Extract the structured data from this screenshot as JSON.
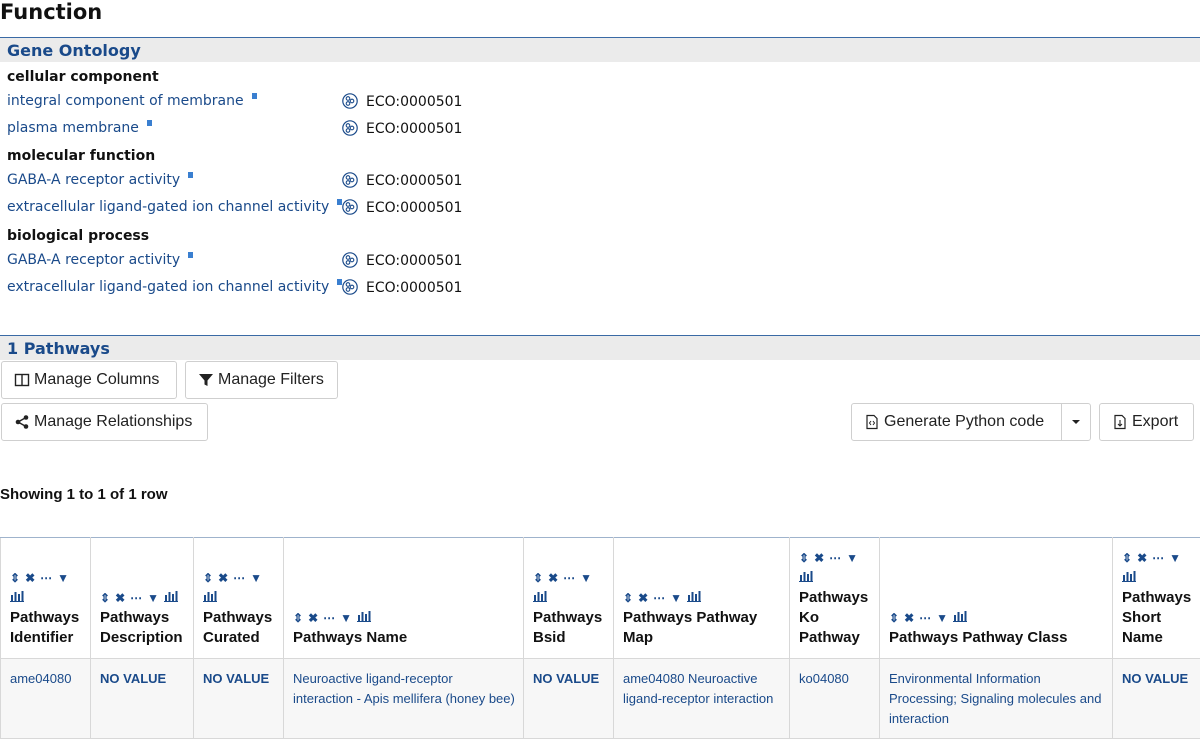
{
  "page_title": "Function",
  "gene_ontology": {
    "header": "Gene Ontology",
    "categories": [
      {
        "name": "cellular component",
        "terms": [
          {
            "label": "integral component of membrane",
            "evidence": "ECO:0000501"
          },
          {
            "label": "plasma membrane",
            "evidence": "ECO:0000501"
          }
        ]
      },
      {
        "name": "molecular function",
        "terms": [
          {
            "label": "GABA-A receptor activity",
            "evidence": "ECO:0000501"
          },
          {
            "label": "extracellular ligand-gated ion channel activity",
            "evidence": "ECO:0000501"
          }
        ]
      },
      {
        "name": "biological process",
        "terms": [
          {
            "label": "GABA-A receptor activity",
            "evidence": "ECO:0000501"
          },
          {
            "label": "extracellular ligand-gated ion channel activity",
            "evidence": "ECO:0000501"
          }
        ]
      }
    ]
  },
  "pathways": {
    "header": "1 Pathways",
    "buttons": {
      "manage_columns": "Manage Columns",
      "manage_filters": "Manage Filters",
      "manage_relationships": "Manage Relationships",
      "generate_python": "Generate Python code",
      "export": "Export"
    },
    "showing": "Showing 1 to 1 of 1 row",
    "columns": [
      "Pathways Identifier",
      "Pathways Description",
      "Pathways Curated",
      "Pathways Name",
      "Pathways Bsid",
      "Pathways Pathway Map",
      "Pathways Ko Pathway",
      "Pathways Pathway Class",
      "Pathways Short Name"
    ],
    "rows": [
      [
        "ame04080",
        "NO VALUE",
        "NO VALUE",
        "Neuroactive ligand-receptor interaction - Apis mellifera (honey bee)",
        "NO VALUE",
        "ame04080 Neuroactive ligand-receptor interaction",
        "ko04080",
        "Environmental Information Processing; Signaling molecules and interaction",
        "NO VALUE"
      ]
    ]
  }
}
